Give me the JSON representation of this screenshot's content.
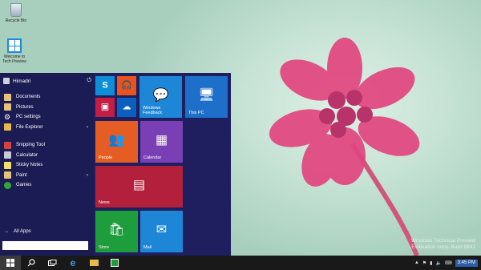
{
  "desktop": {
    "icons": [
      {
        "label": "Recycle Bin",
        "icon": "recycle-bin-icon"
      },
      {
        "label": "Welcome to Tech Preview",
        "icon": "windows-logo-icon"
      }
    ],
    "watermark": {
      "line1": "Windows Technical Preview",
      "line2": "Evaluation copy. Build 9841"
    }
  },
  "start_menu": {
    "user": {
      "name": "Himadri",
      "power_icon": "power-icon"
    },
    "places": [
      {
        "label": "Documents",
        "icon": "documents-icon",
        "color": "#e6c27a"
      },
      {
        "label": "Pictures",
        "icon": "pictures-icon",
        "color": "#e6c27a"
      },
      {
        "label": "PC settings",
        "icon": "gear-icon",
        "color": "#ffffff"
      },
      {
        "label": "File Explorer",
        "icon": "folder-icon",
        "color": "#e8b84a",
        "arrow": "›"
      }
    ],
    "apps": [
      {
        "label": "Snipping Tool",
        "icon": "scissors-icon",
        "color": "#d94040"
      },
      {
        "label": "Calculator",
        "icon": "calculator-icon",
        "color": "#c9c9d8"
      },
      {
        "label": "Sticky Notes",
        "icon": "sticky-note-icon",
        "color": "#f3e06a"
      },
      {
        "label": "Paint",
        "icon": "paint-icon",
        "color": "#e6c27a",
        "arrow": "›"
      },
      {
        "label": "Games",
        "icon": "xbox-icon",
        "color": "#2fa83a"
      }
    ],
    "all_apps": {
      "label": "All Apps",
      "arrow": "→"
    },
    "search": {
      "value": "",
      "placeholder": ""
    },
    "tiles": [
      {
        "name": "tile-skype",
        "label": "",
        "glyph": "S",
        "color": "#0f8ed8"
      },
      {
        "name": "tile-music",
        "label": "",
        "glyph": "🎧",
        "color": "#e8531f"
      },
      {
        "name": "tile-video",
        "label": "",
        "glyph": "▣",
        "color": "#c31d43"
      },
      {
        "name": "tile-onedrive",
        "label": "",
        "glyph": "☁",
        "color": "#0a5fbf"
      },
      {
        "name": "tile-windows-feedback",
        "label": "Windows Feedback",
        "glyph": "💬",
        "color": "#1d86d6"
      },
      {
        "name": "tile-this-pc",
        "label": "This PC",
        "glyph": "🖥",
        "color": "#1d6fc9"
      },
      {
        "name": "tile-people",
        "label": "People",
        "glyph": "👥",
        "color": "#e55d23"
      },
      {
        "name": "tile-calendar",
        "label": "Calendar",
        "glyph": "▦",
        "color": "#7a3fb5"
      },
      {
        "name": "tile-news",
        "label": "News",
        "glyph": "▤",
        "color": "#b3203c"
      },
      {
        "name": "tile-store",
        "label": "Store",
        "glyph": "🛍",
        "color": "#1e9d3c"
      },
      {
        "name": "tile-mail",
        "label": "Mail",
        "glyph": "✉",
        "color": "#1d86d6"
      }
    ]
  },
  "taskbar": {
    "buttons": [
      {
        "name": "start-button",
        "icon": "windows-logo-icon"
      },
      {
        "name": "search-button",
        "icon": "search-icon"
      },
      {
        "name": "task-view-button",
        "icon": "task-view-icon"
      },
      {
        "name": "internet-explorer-button",
        "icon": "internet-explorer-icon"
      },
      {
        "name": "file-explorer-button",
        "icon": "folder-icon"
      },
      {
        "name": "store-button",
        "icon": "store-icon"
      }
    ],
    "tray": {
      "chevron": "▲",
      "time": "3:45 PM",
      "date": ""
    }
  }
}
